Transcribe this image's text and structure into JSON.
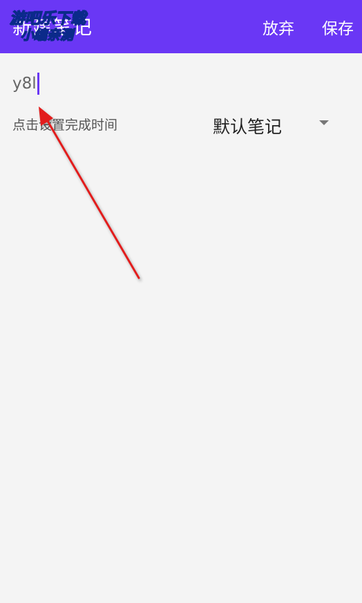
{
  "appbar": {
    "title": "新建笔记",
    "discard_label": "放弃",
    "save_label": "保存",
    "watermark_line1": "游吧乐下载",
    "watermark_line2": "小编亲测",
    "background_color": "#6a37f5"
  },
  "editor": {
    "title_value": "y8l"
  },
  "options": {
    "time_label": "点击设置完成时间",
    "category_label": "默认笔记",
    "category_icon": "dropdown-arrow-icon"
  },
  "annotation": {
    "arrow_color": "#e21b1b",
    "icon": "red-arrow-annotation"
  }
}
